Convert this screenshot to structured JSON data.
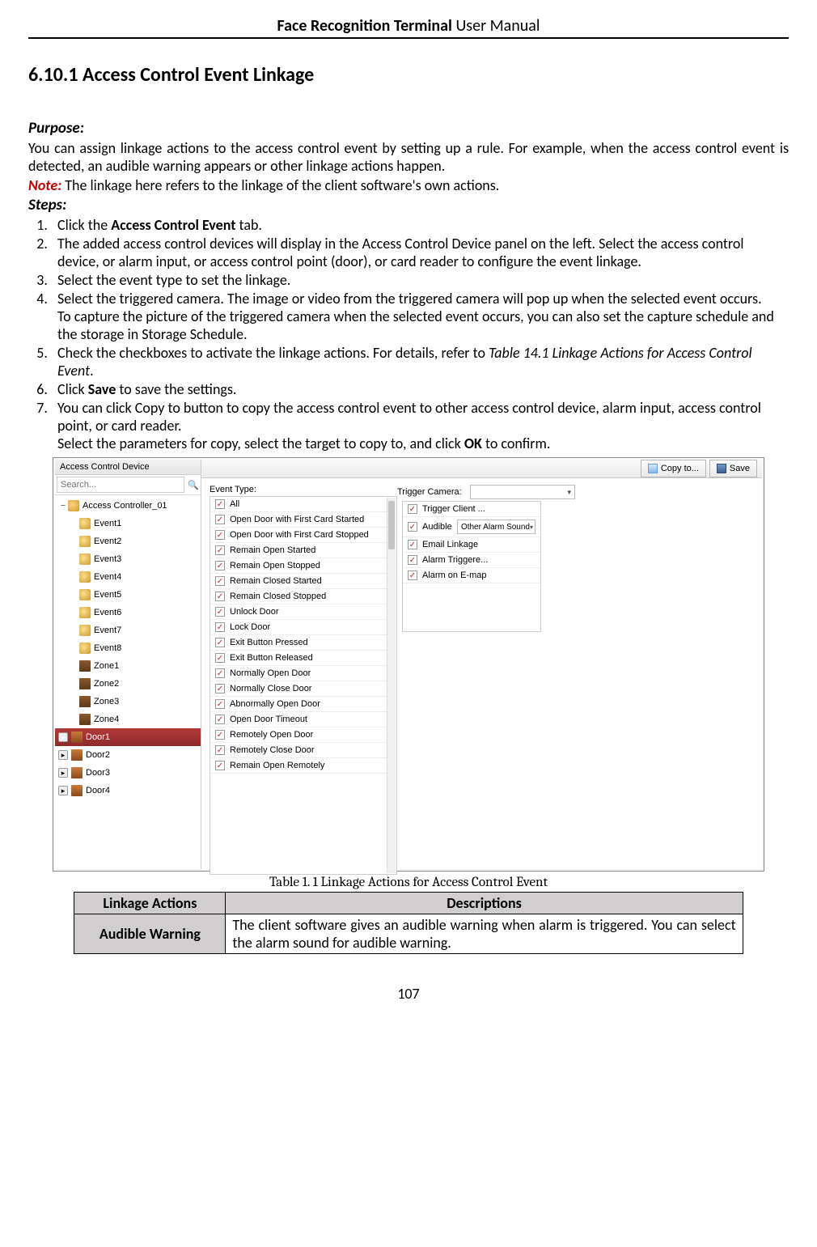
{
  "header": {
    "bold": "Face Recognition Terminal",
    "rest": "  User Manual"
  },
  "section": {
    "number": "6.10.1",
    "title": "Access Control Event Linkage"
  },
  "purpose_label": "Purpose:",
  "purpose_text": "You can assign linkage actions to the access control event by setting up a rule. For example, when the access control event is detected, an audible warning appears or other linkage actions happen.",
  "note_label": "Note:",
  "note_text": " The linkage here refers to the linkage of the client software's own actions.",
  "steps_label": "Steps:",
  "steps": [
    {
      "pre": "Click the ",
      "bold": "Access Control Event",
      "post": " tab."
    },
    {
      "pre": "The added access control devices will display in the Access Control Device panel on the left. Select the access control device, or alarm input, or access control point (door), or card reader to configure the event linkage."
    },
    {
      "pre": "Select the event type to set the linkage."
    },
    {
      "pre": "Select the triggered camera. The image or video from the triggered camera will pop up when the selected event occurs.\nTo capture the picture of the triggered camera when the selected event occurs, you can also set the capture schedule and the storage in Storage Schedule."
    },
    {
      "pre": "Check the checkboxes to activate the linkage actions. For details, refer to ",
      "ref": "Table 14.1 Linkage Actions for Access Control Event",
      "post": "."
    },
    {
      "pre": "Click ",
      "bold": "Save",
      "post": " to save the settings."
    },
    {
      "pre": "You can click Copy to button to copy the access control event to other access control device, alarm input, access control point, or card reader.\nSelect the parameters for copy, select the target to copy to, and click ",
      "bold": "OK",
      "post": " to confirm."
    }
  ],
  "screenshot": {
    "sidebar_title": "Access Control Device",
    "search_placeholder": "Search...",
    "tree_root": "Access Controller_01",
    "events": [
      "Event1",
      "Event2",
      "Event3",
      "Event4",
      "Event5",
      "Event6",
      "Event7",
      "Event8"
    ],
    "zones": [
      "Zone1",
      "Zone2",
      "Zone3",
      "Zone4"
    ],
    "doors": [
      "Door1",
      "Door2",
      "Door3",
      "Door4"
    ],
    "selected_door_index": 0,
    "toolbar": {
      "copy": "Copy to...",
      "save": "Save"
    },
    "event_type_label": "Event Type:",
    "trigger_camera_label": "Trigger Camera:",
    "event_types": [
      "All",
      "Open Door with First Card Started",
      "Open Door with First Card Stopped",
      "Remain Open Started",
      "Remain Open Stopped",
      "Remain Closed Started",
      "Remain Closed Stopped",
      "Unlock Door",
      "Lock Door",
      "Exit Button Pressed",
      "Exit Button Released",
      "Normally Open Door",
      "Normally Close Door",
      "Abnormally Open Door",
      "Open Door Timeout",
      "Remotely Open Door",
      "Remotely Close Door",
      "Remain Open Remotely"
    ],
    "linkages": [
      {
        "label": "Trigger Client ...",
        "extra": ""
      },
      {
        "label": "Audible Warning",
        "extra": "Other Alarm Sound"
      },
      {
        "label": "Email Linkage",
        "extra": ""
      },
      {
        "label": "Alarm Triggere...",
        "extra": ""
      },
      {
        "label": "Alarm on E-map",
        "extra": ""
      }
    ]
  },
  "table_caption": "Table 1. 1  Linkage Actions for Access Control Event",
  "table": {
    "head_left": "Linkage Actions",
    "head_right": "Descriptions",
    "rows": [
      {
        "name": "Audible Warning",
        "desc": "The client software gives an audible warning when alarm is triggered. You can select the alarm sound for audible warning."
      }
    ]
  },
  "page_number": "107"
}
